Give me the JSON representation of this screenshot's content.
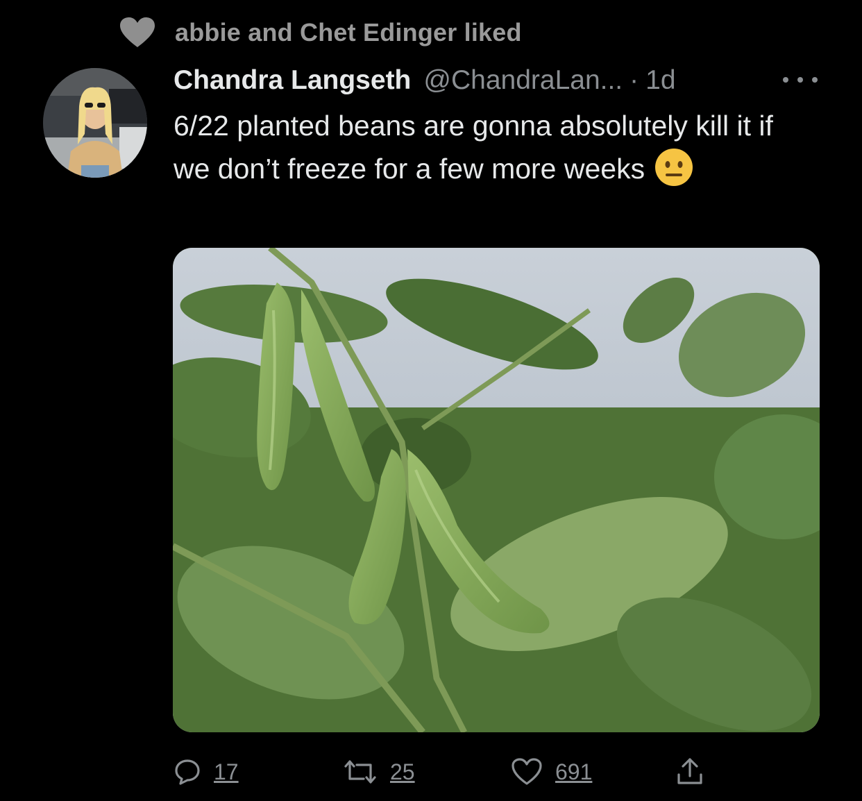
{
  "social_context": {
    "text": "abbie and Chet Edinger liked",
    "icon": "heart-icon"
  },
  "tweet": {
    "display_name": "Chandra Langseth",
    "handle": "@ChandraLan...",
    "separator": "·",
    "time": "1d",
    "text": "6/22 planted beans are gonna absolutely kill it if we don’t freeze for a few more weeks",
    "emoji": "neutral-face-emoji",
    "media": "photo of green soybean pods hanging among leaves"
  },
  "actions": {
    "reply_count": "17",
    "retweet_count": "25",
    "like_count": "691"
  },
  "colors": {
    "background": "#000000",
    "primary_text": "#e7e9ea",
    "secondary_text": "#8b8f93",
    "context_text": "#9a9a9a"
  }
}
